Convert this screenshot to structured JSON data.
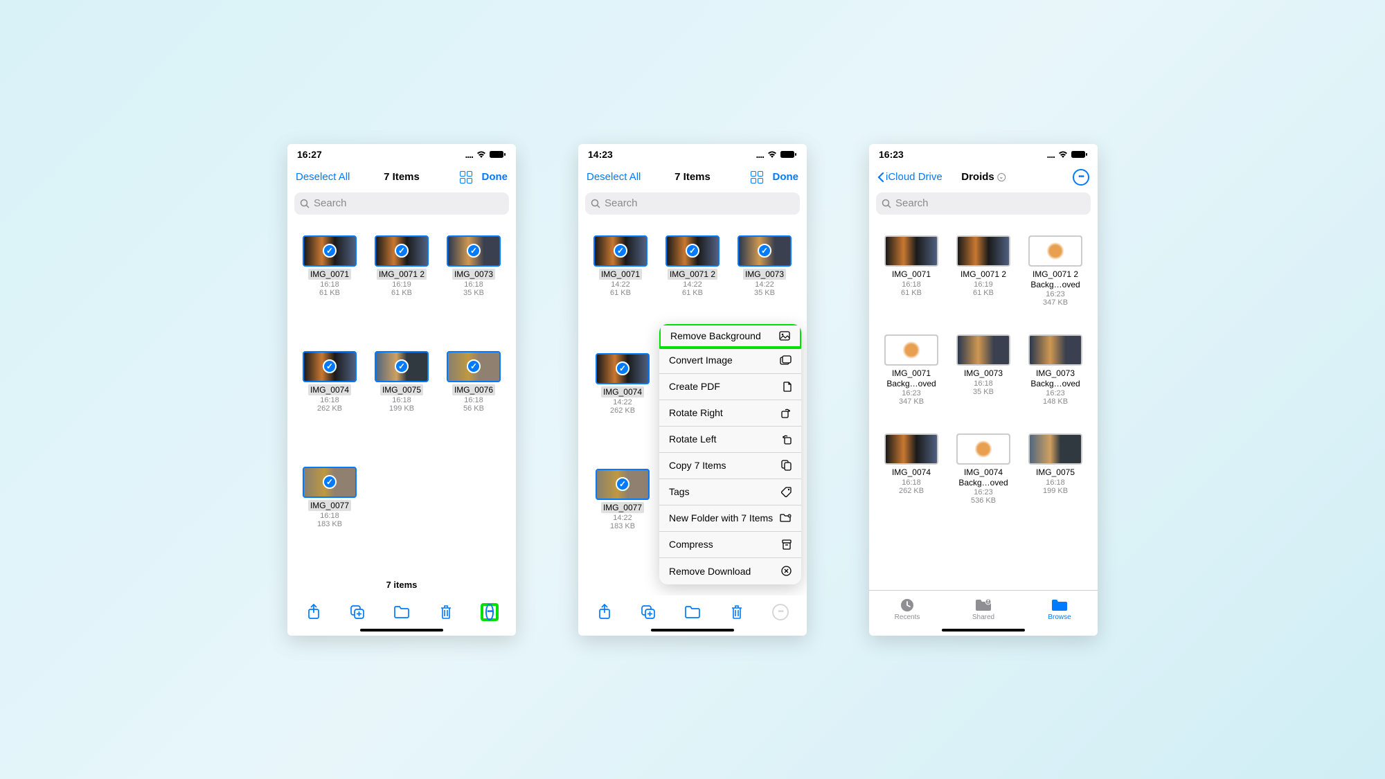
{
  "status": {
    "time1": "16:27",
    "time2": "14:23",
    "time3": "16:23",
    "dots": "....",
    "wifi": "wifi",
    "battery": "battery"
  },
  "nav": {
    "deselect": "Deselect All",
    "items_title": "7 Items",
    "done": "Done",
    "back": "iCloud Drive",
    "folder_title": "Droids"
  },
  "search": {
    "placeholder": "Search"
  },
  "summary": {
    "item_count": "7 items"
  },
  "screen1_files": [
    {
      "name": "IMG_0071",
      "time": "16:18",
      "size": "61 KB",
      "v": "v1"
    },
    {
      "name": "IMG_0071 2",
      "time": "16:19",
      "size": "61 KB",
      "v": "v1"
    },
    {
      "name": "IMG_0073",
      "time": "16:18",
      "size": "35 KB",
      "v": "v2"
    },
    {
      "name": "IMG_0074",
      "time": "16:18",
      "size": "262 KB",
      "v": "v1"
    },
    {
      "name": "IMG_0075",
      "time": "16:18",
      "size": "199 KB",
      "v": "v3"
    },
    {
      "name": "IMG_0076",
      "time": "16:18",
      "size": "56 KB",
      "v": "v4"
    },
    {
      "name": "IMG_0077",
      "time": "16:18",
      "size": "183 KB",
      "v": "v4"
    }
  ],
  "screen2_files_row1": [
    {
      "name": "IMG_0071",
      "time": "14:22",
      "size": "61 KB",
      "v": "v1"
    },
    {
      "name": "IMG_0071 2",
      "time": "14:22",
      "size": "61 KB",
      "v": "v1"
    },
    {
      "name": "IMG_0073",
      "time": "14:22",
      "size": "35 KB",
      "v": "v2"
    }
  ],
  "screen2_files_col": [
    {
      "name": "IMG_0074",
      "time": "14:22",
      "size": "262 KB",
      "v": "v1"
    },
    {
      "name": "IMG_0077",
      "time": "14:22",
      "size": "183 KB",
      "v": "v4"
    }
  ],
  "menu": [
    {
      "label": "Remove Background",
      "icon": "image-remove-icon",
      "hl": true
    },
    {
      "label": "Convert Image",
      "icon": "images-icon",
      "hl": false
    },
    {
      "label": "Create PDF",
      "icon": "document-icon",
      "hl": false
    },
    {
      "label": "Rotate Right",
      "icon": "rotate-right-icon",
      "hl": false
    },
    {
      "label": "Rotate Left",
      "icon": "rotate-left-icon",
      "hl": false
    },
    {
      "label": "Copy 7 Items",
      "icon": "copy-icon",
      "hl": false
    },
    {
      "label": "Tags",
      "icon": "tag-icon",
      "hl": false
    },
    {
      "label": "New Folder with 7 Items",
      "icon": "folder-plus-icon",
      "hl": false
    },
    {
      "label": "Compress",
      "icon": "archive-icon",
      "hl": false
    },
    {
      "label": "Remove Download",
      "icon": "remove-download-icon",
      "hl": false
    }
  ],
  "screen3_files": [
    {
      "name": "IMG_0071",
      "name2": "",
      "time": "16:18",
      "size": "61 KB",
      "v": "v1"
    },
    {
      "name": "IMG_0071 2",
      "name2": "",
      "time": "16:19",
      "size": "61 KB",
      "v": "v1"
    },
    {
      "name": "IMG_0071 2",
      "name2": "Backg…oved",
      "time": "16:23",
      "size": "347 KB",
      "v": "v5"
    },
    {
      "name": "IMG_0071",
      "name2": "Backg…oved",
      "time": "16:23",
      "size": "347 KB",
      "v": "v5"
    },
    {
      "name": "IMG_0073",
      "name2": "",
      "time": "16:18",
      "size": "35 KB",
      "v": "v2"
    },
    {
      "name": "IMG_0073",
      "name2": "Backg…oved",
      "time": "16:23",
      "size": "148 KB",
      "v": "v2"
    },
    {
      "name": "IMG_0074",
      "name2": "",
      "time": "16:18",
      "size": "262 KB",
      "v": "v1"
    },
    {
      "name": "IMG_0074",
      "name2": "Backg…oved",
      "time": "16:23",
      "size": "536 KB",
      "v": "v5"
    },
    {
      "name": "IMG_0075",
      "name2": "",
      "time": "16:18",
      "size": "199 KB",
      "v": "v3"
    }
  ],
  "tabs": {
    "recents": "Recents",
    "shared": "Shared",
    "browse": "Browse"
  }
}
